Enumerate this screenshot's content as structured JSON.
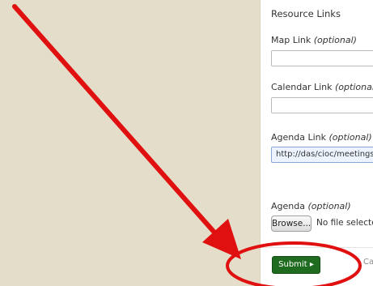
{
  "resource_links": {
    "section_title": "Resource Links",
    "map_link": {
      "label": "Map Link",
      "optional": "(optional)",
      "value": ""
    },
    "calendar_link": {
      "label": "Calendar Link",
      "optional": "(optional)",
      "value": ""
    },
    "agenda_link": {
      "label": "Agenda Link",
      "optional": "(optional)",
      "value": "http://das/cioc/meetings"
    },
    "agenda_file": {
      "label": "Agenda",
      "optional": "(optional)",
      "browse_label": "Browse...",
      "no_file_text": "No file selected."
    }
  },
  "actions": {
    "submit_label": "Submit",
    "submit_arrow": "▸",
    "cancel_label": "Cancel"
  },
  "colors": {
    "background": "#e3ddca",
    "submit_button": "#1f6b1f",
    "annotation": "#e01010"
  }
}
